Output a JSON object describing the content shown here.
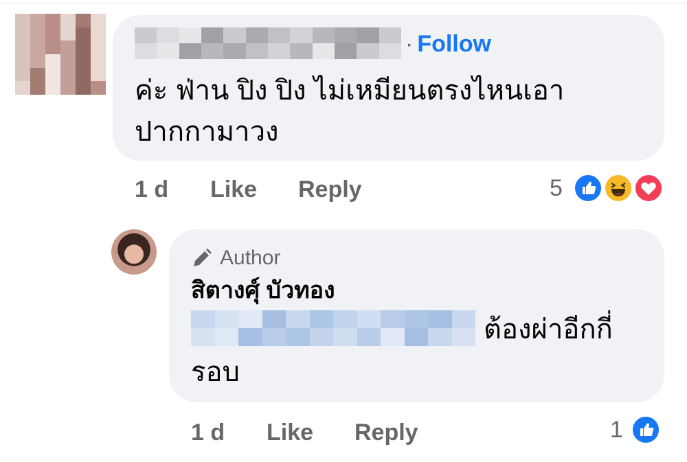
{
  "colors": {
    "accent": "#1877f2",
    "bubble": "#f0f2f5",
    "meta": "#65676b",
    "like": "#1877f2",
    "haha": "#f7b928",
    "love": "#f33e58"
  },
  "comment1": {
    "follow_label": "Follow",
    "text": "ค่ะ ฟ่าน ปิง ปิง ไม่เหมียนตรงไหนเอา\nปากกามาวง",
    "time": "1 d",
    "like_label": "Like",
    "reply_label": "Reply",
    "reaction_count": "5",
    "reactions": [
      "like-icon",
      "haha-icon",
      "love-icon"
    ]
  },
  "reply1": {
    "badge_label": "Author",
    "badge_icon": "pencil-icon",
    "author_name": "สิตางศุ์ บัวทอง",
    "text_line1": "ต้องผ่าอีกกี่",
    "text_line2": "รอบ",
    "time": "1 d",
    "like_label": "Like",
    "reply_label": "Reply",
    "reaction_count": "1",
    "reactions": [
      "like-icon"
    ]
  }
}
